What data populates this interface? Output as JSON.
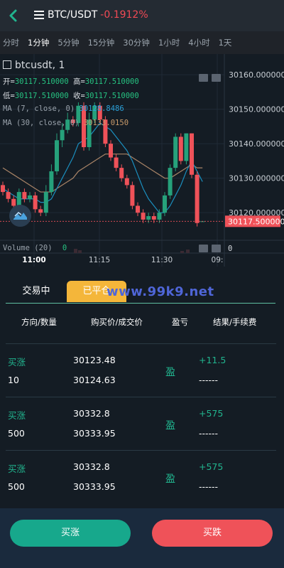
{
  "header": {
    "title": "BTC/USDT",
    "change": "-0.1912%"
  },
  "timeframes": [
    "分时",
    "1分钟",
    "5分钟",
    "15分钟",
    "30分钟",
    "1小时",
    "4小时",
    "1天"
  ],
  "chart_overlay": {
    "symbol": "btcusdt, 1",
    "ohlc": {
      "open_label": "开=",
      "open": "30117.510000",
      "high_label": "高=",
      "high": "30117.510000",
      "low_label": "低=",
      "low": "30117.510000",
      "close_label": "收=",
      "close": "30117.510000"
    },
    "ma7_label": "MA (7, close, 0)",
    "ma7_value": "30128.8486",
    "ma30_label": "MA (30, close, 0)",
    "ma30_value": "30133.0150",
    "volume_label": "Volume (20)",
    "volume_value": "0",
    "volume_axis": "0"
  },
  "chart_data": {
    "type": "candlestick",
    "y_ticks": [
      "30160.000000",
      "30150.000000",
      "30140.000000",
      "30130.000000",
      "30120.000000"
    ],
    "ylim": [
      30112,
      30166
    ],
    "current_price": "30117.500000",
    "x_ticks": [
      "11:00",
      "11:15",
      "11:30",
      "09:"
    ],
    "candles": [
      {
        "o": 30128,
        "c": 30126,
        "h": 30129,
        "l": 30125
      },
      {
        "o": 30126,
        "c": 30124,
        "h": 30127,
        "l": 30123
      },
      {
        "o": 30124,
        "c": 30122,
        "h": 30125,
        "l": 30121
      },
      {
        "o": 30122,
        "c": 30126,
        "h": 30127,
        "l": 30121
      },
      {
        "o": 30126,
        "c": 30124,
        "h": 30127,
        "l": 30123
      },
      {
        "o": 30124,
        "c": 30125,
        "h": 30126,
        "l": 30123
      },
      {
        "o": 30125,
        "c": 30121,
        "h": 30126,
        "l": 30120
      },
      {
        "o": 30121,
        "c": 30120,
        "h": 30122,
        "l": 30119
      },
      {
        "o": 30120,
        "c": 30126,
        "h": 30128,
        "l": 30119
      },
      {
        "o": 30126,
        "c": 30132,
        "h": 30134,
        "l": 30125
      },
      {
        "o": 30132,
        "c": 30141,
        "h": 30143,
        "l": 30131
      },
      {
        "o": 30141,
        "c": 30144,
        "h": 30146,
        "l": 30139
      },
      {
        "o": 30144,
        "c": 30147,
        "h": 30149,
        "l": 30143
      },
      {
        "o": 30147,
        "c": 30146,
        "h": 30148,
        "l": 30145
      },
      {
        "o": 30146,
        "c": 30151,
        "h": 30152,
        "l": 30145
      },
      {
        "o": 30151,
        "c": 30139,
        "h": 30152,
        "l": 30138
      },
      {
        "o": 30139,
        "c": 30147,
        "h": 30149,
        "l": 30138
      },
      {
        "o": 30147,
        "c": 30151,
        "h": 30152,
        "l": 30146
      },
      {
        "o": 30151,
        "c": 30147,
        "h": 30152,
        "l": 30146
      },
      {
        "o": 30147,
        "c": 30140,
        "h": 30148,
        "l": 30139
      },
      {
        "o": 30140,
        "c": 30136,
        "h": 30141,
        "l": 30135
      },
      {
        "o": 30136,
        "c": 30133,
        "h": 30137,
        "l": 30132
      },
      {
        "o": 30133,
        "c": 30130,
        "h": 30134,
        "l": 30129
      },
      {
        "o": 30130,
        "c": 30128,
        "h": 30131,
        "l": 30127
      },
      {
        "o": 30128,
        "c": 30122,
        "h": 30129,
        "l": 30121
      },
      {
        "o": 30122,
        "c": 30120,
        "h": 30123,
        "l": 30119
      },
      {
        "o": 30120,
        "c": 30118,
        "h": 30121,
        "l": 30117
      },
      {
        "o": 30118,
        "c": 30119,
        "h": 30120,
        "l": 30117
      },
      {
        "o": 30119,
        "c": 30118,
        "h": 30120,
        "l": 30117
      },
      {
        "o": 30118,
        "c": 30120,
        "h": 30121,
        "l": 30117
      },
      {
        "o": 30120,
        "c": 30125,
        "h": 30126,
        "l": 30119
      },
      {
        "o": 30125,
        "c": 30133,
        "h": 30134,
        "l": 30124
      },
      {
        "o": 30133,
        "c": 30142,
        "h": 30143,
        "l": 30132
      },
      {
        "o": 30142,
        "c": 30135,
        "h": 30143,
        "l": 30134
      },
      {
        "o": 30135,
        "c": 30143,
        "h": 30143,
        "l": 30134
      },
      {
        "o": 30143,
        "c": 30131,
        "h": 30143,
        "l": 30130
      },
      {
        "o": 30131,
        "c": 30117,
        "h": 30132,
        "l": 30116
      },
      {
        "o": 30117.5,
        "c": 30117.5,
        "h": 30117.5,
        "l": 30117.5
      }
    ],
    "ma7": [
      30127,
      30126,
      30125,
      30124,
      30124,
      30124,
      30124,
      30123,
      30123,
      30124,
      30127,
      30130,
      30133,
      30136,
      30140,
      30141,
      30142,
      30144,
      30146,
      30145,
      30144,
      30142,
      30140,
      30138,
      30135,
      30131,
      30127,
      30124,
      30122,
      30120,
      30120,
      30122,
      30125,
      30128,
      30132,
      30135,
      30132,
      30129
    ],
    "ma30": [
      30133,
      30132,
      30131,
      30130,
      30129,
      30128,
      30127,
      30126,
      30126,
      30126,
      30127,
      30128,
      30129,
      30130,
      30132,
      30133,
      30134,
      30135,
      30136,
      30137,
      30137,
      30137,
      30137,
      30137,
      30136,
      30135,
      30134,
      30133,
      30132,
      30131,
      30130,
      30130,
      30131,
      30132,
      30133,
      30134,
      30133,
      30133
    ]
  },
  "trade": {
    "tab_trading": "交易中",
    "tab_closed": "已平仓",
    "watermark": "www.99k9.net",
    "columns": [
      "方向/数量",
      "购买价/成交价",
      "盈亏",
      "结果/手续费"
    ],
    "rows": [
      {
        "direction": "买涨",
        "qty": "10",
        "buy_price": "30123.48",
        "deal_price": "30124.63",
        "pnl": "盈",
        "result": "+11.5",
        "fee": "------"
      },
      {
        "direction": "买涨",
        "qty": "500",
        "buy_price": "30332.8",
        "deal_price": "30333.95",
        "pnl": "盈",
        "result": "+575",
        "fee": "------"
      },
      {
        "direction": "买涨",
        "qty": "500",
        "buy_price": "30332.8",
        "deal_price": "30333.95",
        "pnl": "盈",
        "result": "+575",
        "fee": "------"
      }
    ]
  },
  "footer": {
    "buy_up": "买涨",
    "buy_down": "买跌"
  },
  "colors": {
    "up": "#26a17b",
    "down": "#ef5259",
    "accent": "#17a88c",
    "tab_active": "#f4b63a",
    "ma7": "#1b8fbf",
    "ma30": "#a98467"
  }
}
